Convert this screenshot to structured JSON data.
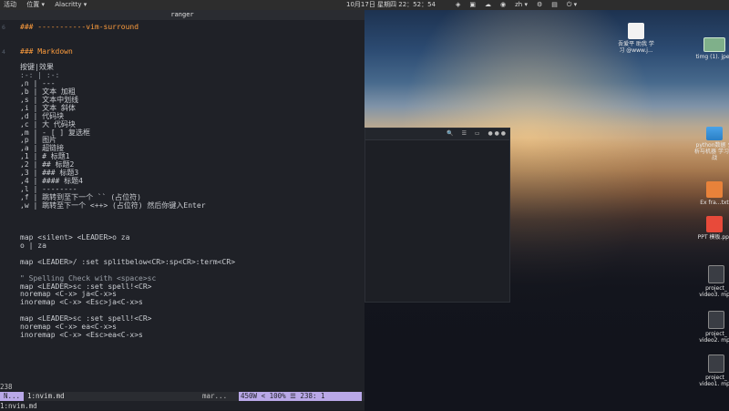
{
  "topbar": {
    "activities": "活动",
    "places": "位置 ▾",
    "app": "Alacritty ▾",
    "datetime": "10月17日 星期四 22：52：54",
    "indicators": [
      "◈",
      "▣",
      "☁",
      "◉",
      "zh ▾",
      "⚙",
      "▤",
      "⏻ ▾"
    ]
  },
  "terminal": {
    "title": "ranger",
    "lines": [
      {
        "n": "6",
        "t": "### -----------vim-surround",
        "c": "hd"
      },
      {
        "n": "",
        "t": "",
        "c": ""
      },
      {
        "n": "",
        "t": "",
        "c": ""
      },
      {
        "n": "4",
        "t": "### Markdown",
        "c": "hd"
      },
      {
        "n": "",
        "t": "",
        "c": ""
      },
      {
        "n": "",
        "t": "按键|效果",
        "c": ""
      },
      {
        "n": "",
        "t": ":-: | :-:",
        "c": "cm"
      },
      {
        "n": "",
        "t": ",n | ---",
        "c": ""
      },
      {
        "n": "",
        "t": ",b | 文本 加粗",
        "c": ""
      },
      {
        "n": "",
        "t": ",s | 文本中划线",
        "c": ""
      },
      {
        "n": "",
        "t": ",i | 文本 斜体",
        "c": ""
      },
      {
        "n": "",
        "t": ",d | 代码块",
        "c": ""
      },
      {
        "n": "",
        "t": ",c | 大 代码块",
        "c": ""
      },
      {
        "n": "",
        "t": ",m | - [ ] 复选框",
        "c": ""
      },
      {
        "n": "",
        "t": ",p | 图片",
        "c": ""
      },
      {
        "n": "",
        "t": ",a | 超链接",
        "c": ""
      },
      {
        "n": "",
        "t": ",1 | # 标题1",
        "c": ""
      },
      {
        "n": "",
        "t": ",2 | ## 标题2",
        "c": ""
      },
      {
        "n": "",
        "t": ",3 | ### 标题3",
        "c": ""
      },
      {
        "n": "",
        "t": ",4 | #### 标题4",
        "c": ""
      },
      {
        "n": "",
        "t": ",l | --------",
        "c": ""
      },
      {
        "n": "",
        "t": ",f | 跳转到至下一个 `` (占位符)",
        "c": ""
      },
      {
        "n": "",
        "t": ",w | 跳转至下一个 <++> (占位符) 然后你键入Enter",
        "c": ""
      },
      {
        "n": "",
        "t": "",
        "c": ""
      },
      {
        "n": "",
        "t": "",
        "c": ""
      },
      {
        "n": "",
        "t": "",
        "c": ""
      },
      {
        "n": "",
        "t": "map <silent> <LEADER>o za",
        "c": ""
      },
      {
        "n": "",
        "t": "o | za",
        "c": ""
      },
      {
        "n": "",
        "t": "",
        "c": ""
      },
      {
        "n": "",
        "t": "map <LEADER>/ :set splitbelow<CR>:sp<CR>:term<CR>",
        "c": ""
      },
      {
        "n": "",
        "t": "",
        "c": ""
      },
      {
        "n": "",
        "t": "\" Spelling Check with <space>sc",
        "c": "cm"
      },
      {
        "n": "",
        "t": "map <LEADER>sc :set spell!<CR>",
        "c": ""
      },
      {
        "n": "",
        "t": "noremap <C-x> ja<C-x>s",
        "c": ""
      },
      {
        "n": "",
        "t": "inoremap <C-x> <Esc>ja<C-x>s",
        "c": ""
      },
      {
        "n": "",
        "t": "",
        "c": ""
      },
      {
        "n": "",
        "t": "map <LEADER>sc :set spell!<CR>",
        "c": ""
      },
      {
        "n": "",
        "t": "noremap <C-x> ea<C-x>s",
        "c": ""
      },
      {
        "n": "",
        "t": "inoremap <C-x> <Esc>ea<C-x>s",
        "c": ""
      }
    ],
    "status": {
      "line_number": "238",
      "mode": "N...",
      "file": "1:nvim.md",
      "middle": "mar...",
      "position": "450W <  100% ☰  238:  1"
    },
    "cmdline": "1:nvim.md"
  },
  "floatwin": {
    "icons": [
      "🔍",
      "☰",
      "▭",
      "● ● ●"
    ]
  },
  "desktop_icons": [
    {
      "label": "吾爱平 助我 学习 @www.j...",
      "kind": "doc"
    },
    {
      "label": "timg (1). jpeg",
      "kind": "img"
    },
    {
      "label": "python数据 分析与机器 学习实战",
      "kind": "folder"
    },
    {
      "label": "Ex fra...txt",
      "kind": "orange"
    },
    {
      "label": "PPT 模板.ppt",
      "kind": "red"
    },
    {
      "label": "project_ video3. mp4",
      "kind": "video"
    },
    {
      "label": "project_ video2. mp4",
      "kind": "video"
    },
    {
      "label": "project_ video1. mp4",
      "kind": "video"
    }
  ]
}
